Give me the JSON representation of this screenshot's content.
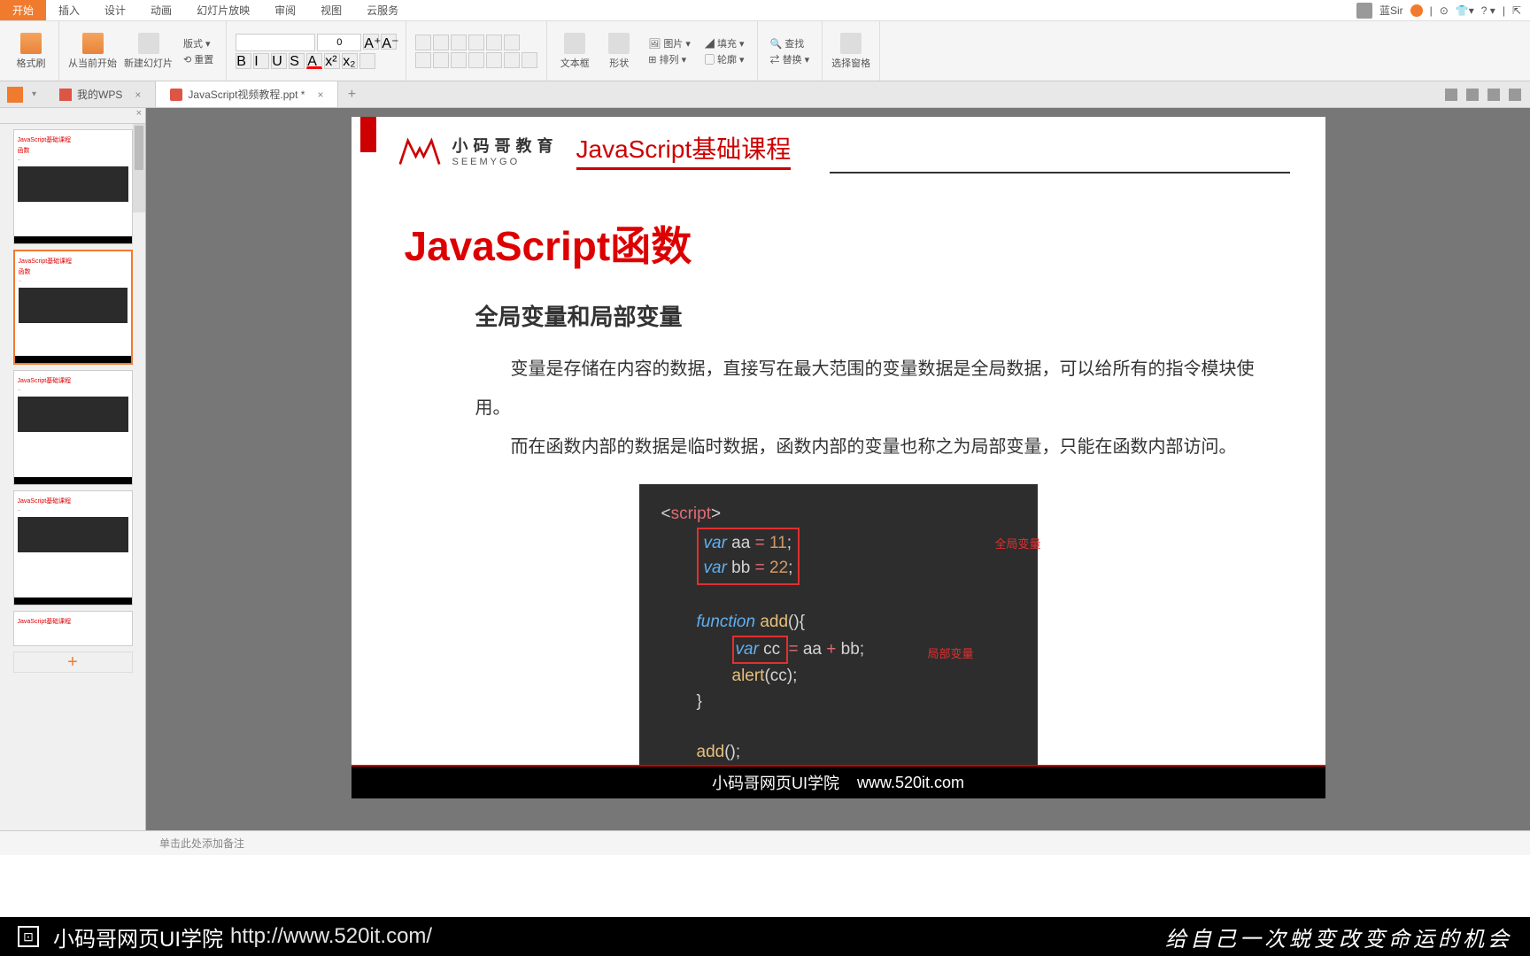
{
  "ribbon": {
    "tabs": [
      "开始",
      "插入",
      "设计",
      "动画",
      "幻灯片放映",
      "审阅",
      "视图",
      "云服务"
    ],
    "active": 0,
    "user": "蓝Sir",
    "groups": {
      "format_painter": "格式刷",
      "start_slideshow": "从当前开始",
      "new_slide": "新建幻灯片",
      "layout": "版式",
      "reset": "重置",
      "font_size": "0",
      "textbox": "文本框",
      "shape": "形状",
      "picture": "图片",
      "arrange": "排列",
      "fill": "填充",
      "outline": "轮廓",
      "find": "查找",
      "replace": "替换",
      "select_pane": "选择窗格"
    }
  },
  "docTabs": {
    "wps": "我的WPS",
    "file": "JavaScript视频教程.ppt *"
  },
  "thumbs": {
    "t1_title": "JavaScript基础课程",
    "t1_sub": "函数",
    "close": "×"
  },
  "slide": {
    "logo_cn": "小码哥教育",
    "logo_en": "SEEMYGO",
    "course": "JavaScript基础课程",
    "title": "JavaScript函数",
    "subtitle": "全局变量和局部变量",
    "p1": "变量是存储在内容的数据，直接写在最大范围的变量数据是全局数据，可以给所有的指令模块使用。",
    "p2": "而在函数内部的数据是临时数据，函数内部的变量也称之为局部变量，只能在函数内部访问。",
    "code": {
      "l1a": "<",
      "l1b": "script",
      "l1c": ">",
      "l2a": "var",
      "l2b": " aa ",
      "l2c": "=",
      "l2d": " 11",
      "l2e": ";",
      "l3a": "var",
      "l3b": " bb ",
      "l3c": "=",
      "l3d": " 22",
      "l3e": ";",
      "l4a": "function",
      "l4b": " add",
      "l4c": "(){",
      "l5a": "var",
      "l5b": " cc ",
      "l5c": "=",
      "l5d": " aa ",
      "l5e": "+",
      "l5f": " bb",
      "l5g": ";",
      "l6a": "alert",
      "l6b": "(cc);",
      "l7": "}",
      "l8a": "add",
      "l8b": "();",
      "anno1": "全局变量",
      "anno2": "局部变量"
    },
    "footer_name": "小码哥网页UI学院",
    "footer_url": "www.520it.com"
  },
  "notes": "单击此处添加备注",
  "overlay": {
    "name": "小码哥网页UI学院",
    "url": "http://www.520it.com/",
    "slogan": "给自己一次蜕变改变命运的机会"
  }
}
